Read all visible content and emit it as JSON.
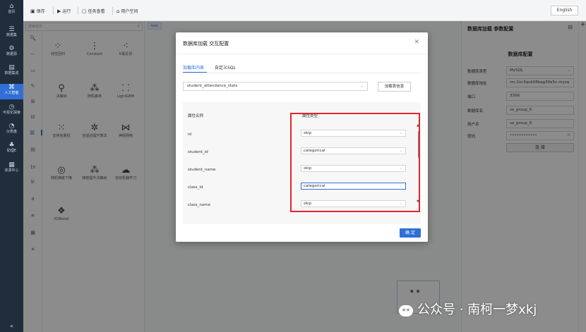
{
  "nav": {
    "items": [
      {
        "icon": "home-icon",
        "glyph": "⌂",
        "label": "首页"
      },
      {
        "icon": "data-list-icon",
        "glyph": "☰",
        "label": "数据集"
      },
      {
        "icon": "data-source-icon",
        "glyph": "⚙",
        "label": "数据源"
      },
      {
        "icon": "data-integration-icon",
        "glyph": "▤",
        "label": "数据集成"
      },
      {
        "icon": "ai-icon",
        "glyph": "⌘",
        "label": "人工智能"
      },
      {
        "icon": "visualization-icon",
        "glyph": "◷",
        "label": "可视化探索"
      },
      {
        "icon": "dashboard-icon",
        "glyph": "◔",
        "label": "仪表盘"
      },
      {
        "icon": "org-icon",
        "glyph": "♣",
        "label": "助理E"
      },
      {
        "icon": "resource-icon",
        "glyph": "▦",
        "label": "资源中心"
      }
    ],
    "collapse_glyph": "«"
  },
  "toolbar": {
    "save": "保存",
    "run": "运行",
    "task_view": "任务查看",
    "user_space": "用户空间",
    "language": "English"
  },
  "components": {
    "search_placeholder": "搜索组件",
    "items": [
      {
        "icon": "linear-regression-icon",
        "glyph": "⁘",
        "label": "线性回归"
      },
      {
        "icon": "constant-icon",
        "glyph": "⋮",
        "label": "Constant"
      },
      {
        "icon": "knn-icon",
        "glyph": "⁖",
        "label": "K最近邻"
      },
      {
        "icon": "decision-tree-icon",
        "glyph": "⚲",
        "label": "决策树"
      },
      {
        "icon": "random-forest-icon",
        "glyph": "⁂",
        "label": "随机森林"
      },
      {
        "icon": "lightgbm-icon",
        "glyph": "⸬",
        "label": "LightGBM"
      },
      {
        "icon": "svm-icon",
        "glyph": "⁙",
        "label": "支持向量机"
      },
      {
        "icon": "adaboost-icon",
        "glyph": "✲",
        "label": "自适应提升算法"
      },
      {
        "icon": "neural-net-icon",
        "glyph": "⋈",
        "label": "神经网络"
      },
      {
        "icon": "sgd-icon",
        "glyph": "◎",
        "label": "随机梯度下降"
      },
      {
        "icon": "gbdt-icon",
        "glyph": "⁂",
        "label": "梯度提升决策树"
      },
      {
        "icon": "automl-icon",
        "glyph": "☁",
        "label": "自动机器学习"
      },
      {
        "icon": "xgboost-icon",
        "glyph": "❖",
        "label": "XGBoost"
      }
    ],
    "categories": [
      "🔍",
      "—",
      "▭",
      "✎",
      "⊞",
      "⊟",
      "▥",
      "▤",
      "㏑",
      "⊯",
      "a",
      "≋",
      "▦",
      "✕"
    ]
  },
  "canvas": {
    "tab": "test"
  },
  "config": {
    "title": "数据库加载 参数配置",
    "subtitle": "数据库配置",
    "toggle_glyph": "⊟",
    "fields": [
      {
        "key": "数据库类型",
        "value": "MySQL",
        "select": true
      },
      {
        "key": "数据库地址",
        "value": "rm-2vc3qok06bag39a5n.mysq",
        "select": false
      },
      {
        "key": "端口",
        "value": "3306",
        "select": false
      },
      {
        "key": "数据库名",
        "value": "se_group_6",
        "select": false
      },
      {
        "key": "用户名",
        "value": "se_group_6",
        "select": false
      },
      {
        "key": "密码",
        "value": "••••••••••••",
        "select": false
      }
    ],
    "connect": "连 接"
  },
  "modal": {
    "title": "数据库加载 交互配置",
    "tabs": [
      "加载库内表",
      "自定义SQL"
    ],
    "table_value": "student_attendance_stats",
    "load_button": "加载表信息",
    "col_name_header": "属性名称",
    "col_type_header": "属性类型",
    "rows": [
      {
        "name": "id",
        "type": "skip"
      },
      {
        "name": "student_id",
        "type": "categorical"
      },
      {
        "name": "student_name",
        "type": "skip"
      },
      {
        "name": "class_id",
        "type": "categorical"
      },
      {
        "name": "class_name",
        "type": "skip"
      }
    ],
    "confirm": "确 定"
  },
  "watermark": "公众号 · 南柯一梦xkj",
  "colors": {
    "accent": "#2f6fd6",
    "nav_bg": "#1f2d3d",
    "highlight": "#e8232a"
  }
}
